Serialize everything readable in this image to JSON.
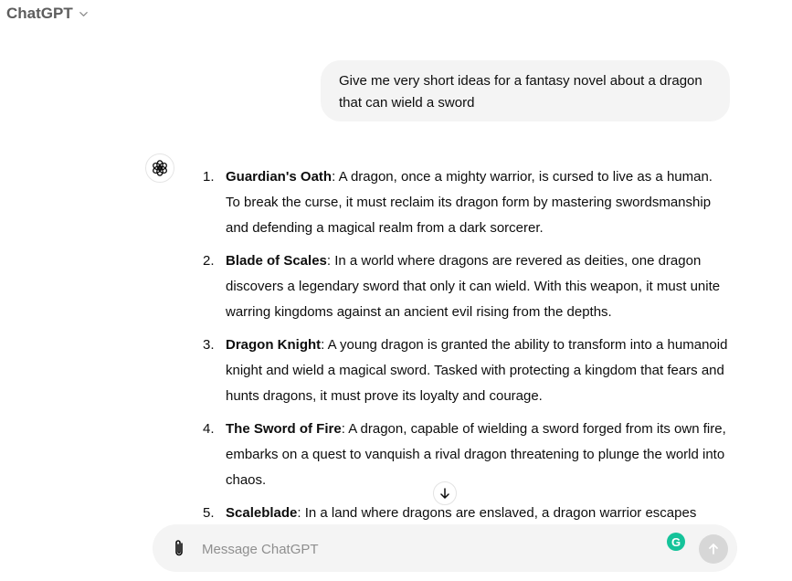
{
  "header": {
    "title": "ChatGPT",
    "icon": "chevron-down-icon"
  },
  "user_message": {
    "text": "Give me very short ideas for a fantasy novel about a dragon that can wield a sword"
  },
  "assistant": {
    "avatar_icon": "openai-logo-icon",
    "ideas": [
      {
        "number": "1.",
        "title": "Guardian's Oath",
        "text": ": A dragon, once a mighty warrior, is cursed to live as a human. To break the curse, it must reclaim its dragon form by mastering swordsmanship and defending a magical realm from a dark sorcerer."
      },
      {
        "number": "2.",
        "title": "Blade of Scales",
        "text": ": In a world where dragons are revered as deities, one dragon discovers a legendary sword that only it can wield. With this weapon, it must unite warring kingdoms against an ancient evil rising from the depths."
      },
      {
        "number": "3.",
        "title": "Dragon Knight",
        "text": ": A young dragon is granted the ability to transform into a humanoid knight and wield a magical sword. Tasked with protecting a kingdom that fears and hunts dragons, it must prove its loyalty and courage."
      },
      {
        "number": "4.",
        "title": "The Sword of Fire",
        "text": ": A dragon, capable of wielding a sword forged from its own fire, embarks on a quest to vanquish a rival dragon threatening to plunge the world into chaos."
      },
      {
        "number": "5.",
        "title": "Scaleblade",
        "text": ": In a land where dragons are enslaved, a dragon warrior escapes"
      }
    ]
  },
  "scroll_button": {
    "icon": "arrow-down-icon"
  },
  "composer": {
    "placeholder": "Message ChatGPT",
    "value": "",
    "attach_icon": "paperclip-icon",
    "grammarly_icon": "grammarly-icon",
    "grammarly_letter": "G",
    "send_icon": "arrow-up-icon"
  },
  "colors": {
    "user_bubble": "#f4f4f4",
    "composer": "#f4f4f4",
    "send_disabled": "#d7d7d7",
    "grammarly": "#15c39a"
  }
}
